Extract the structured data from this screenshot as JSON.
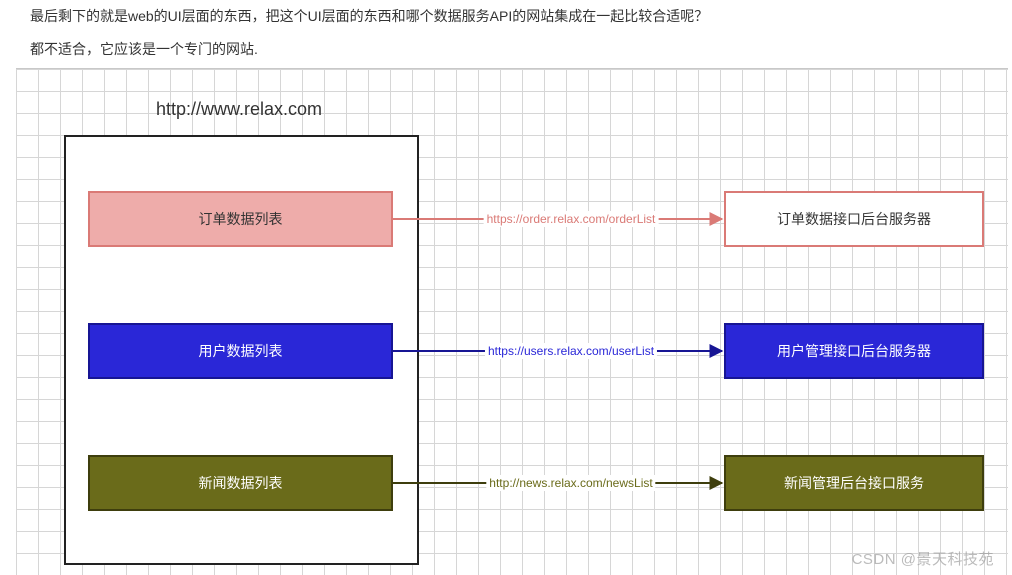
{
  "text": {
    "question": "最后剩下的就是web的UI层面的东西，把这个UI层面的东西和哪个数据服务API的网站集成在一起比较合适呢？",
    "answer": "都不适合，它应该是一个专门的网站."
  },
  "diagram": {
    "title_url": "http://www.relax.com",
    "rows": [
      {
        "left_label": "订单数据列表",
        "link_label": "https://order.relax.com/orderList",
        "right_label": "订单数据接口后台服务器",
        "color": "pink"
      },
      {
        "left_label": "用户数据列表",
        "link_label": "https://users.relax.com/userList",
        "right_label": "用户管理接口后台服务器",
        "color": "blue"
      },
      {
        "left_label": "新闻数据列表",
        "link_label": "http://news.relax.com/newsList",
        "right_label": "新闻管理后台接口服务",
        "color": "olive"
      }
    ]
  },
  "watermark": "CSDN @景天科技苑"
}
